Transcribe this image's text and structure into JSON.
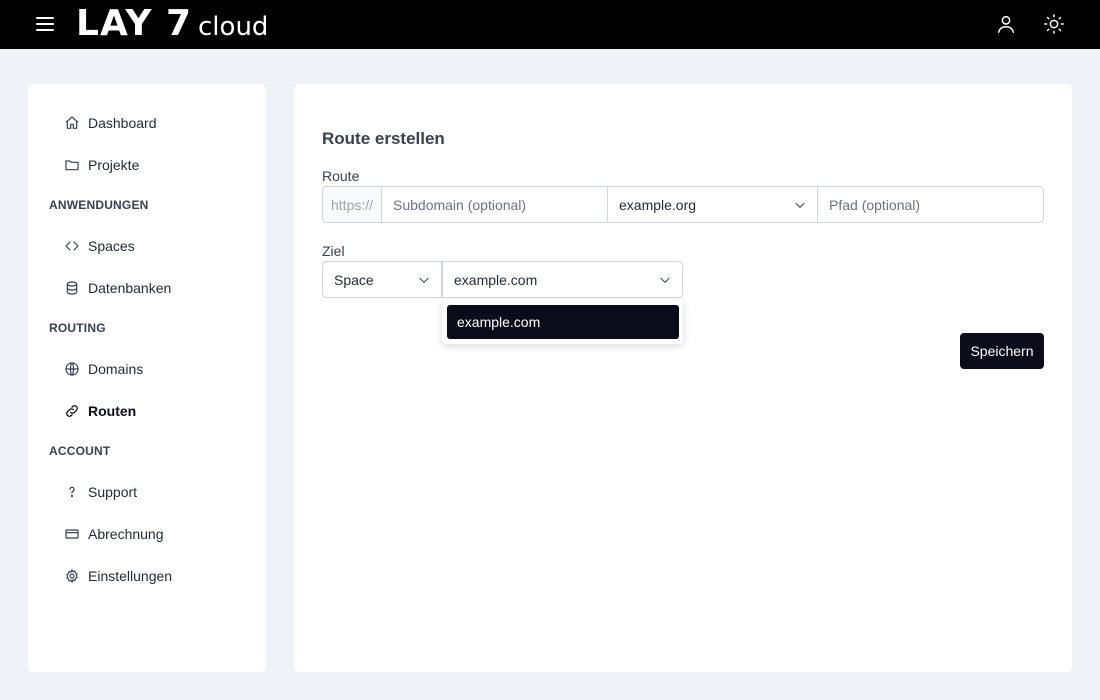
{
  "header": {
    "logo_main": "LAY 7",
    "logo_sub": "cloud",
    "menu_icon": "hamburger-icon",
    "user_icon": "user-icon",
    "theme_icon": "sun-icon"
  },
  "sidebar": {
    "items_top": [
      {
        "label": "Dashboard",
        "icon": "home-icon"
      },
      {
        "label": "Projekte",
        "icon": "folder-icon"
      }
    ],
    "sections": [
      {
        "title": "ANWENDUNGEN",
        "items": [
          {
            "label": "Spaces",
            "icon": "code-icon"
          },
          {
            "label": "Datenbanken",
            "icon": "database-icon"
          }
        ]
      },
      {
        "title": "ROUTING",
        "items": [
          {
            "label": "Domains",
            "icon": "globe-icon"
          },
          {
            "label": "Routen",
            "icon": "link-icon",
            "active": true
          }
        ]
      },
      {
        "title": "ACCOUNT",
        "items": [
          {
            "label": "Support",
            "icon": "question-icon"
          },
          {
            "label": "Abrechnung",
            "icon": "credit-card-icon"
          },
          {
            "label": "Einstellungen",
            "icon": "gear-icon"
          }
        ]
      }
    ]
  },
  "form": {
    "title": "Route erstellen",
    "route_label": "Route",
    "prefix": "https://",
    "subdomain_placeholder": "Subdomain (optional)",
    "domain_value": "example.org",
    "path_placeholder": "Pfad (optional)",
    "target_label": "Ziel",
    "target_type_value": "Space",
    "target_value": "example.com",
    "dropdown_options": [
      "example.com"
    ],
    "save_label": "Speichern"
  },
  "colors": {
    "accent": "#0b0b1a",
    "background": "#eff2f7",
    "topbar": "#000000"
  }
}
